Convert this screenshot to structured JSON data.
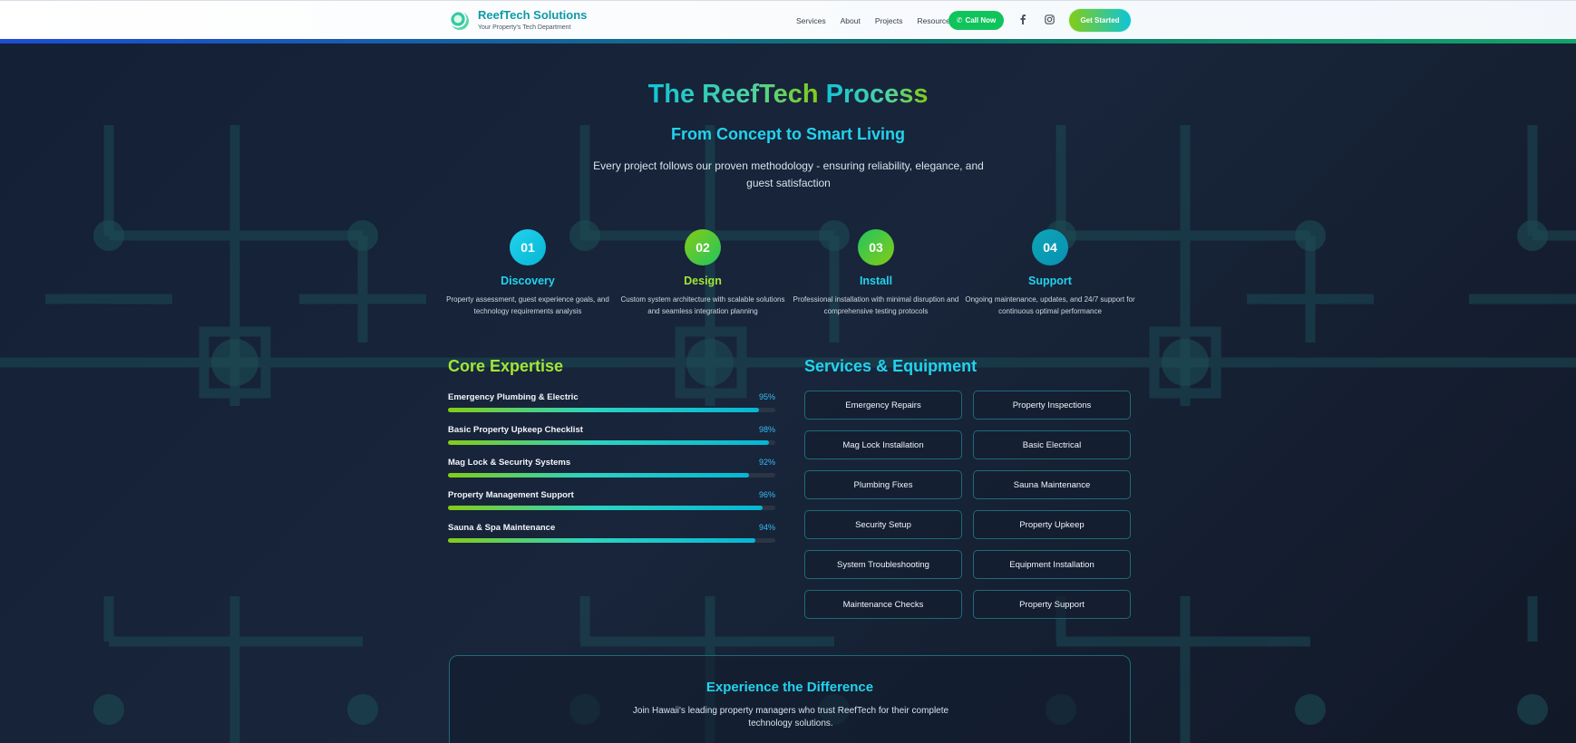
{
  "header": {
    "brand_name": "ReefTech Solutions",
    "brand_tagline": "Your Property's Tech Department",
    "nav": [
      "Services",
      "About",
      "Projects",
      "Resources"
    ],
    "call_label": "Call Now",
    "cta_label": "Get Started",
    "social_icons": [
      "facebook-icon",
      "instagram-icon"
    ]
  },
  "hero": {
    "title_part1": "The ReefTech",
    "title_part2": "Process",
    "subtitle": "From Concept to Smart Living",
    "lead": "Every project follows our proven methodology - ensuring reliability, elegance, and guest satisfaction"
  },
  "steps": [
    {
      "num": "01",
      "name": "Discovery",
      "desc": "Property assessment, guest experience goals, and technology requirements analysis",
      "color": "#22d3ee"
    },
    {
      "num": "02",
      "name": "Design",
      "desc": "Custom system architecture with scalable solutions and seamless integration planning",
      "color": "#a3e635"
    },
    {
      "num": "03",
      "name": "Install",
      "desc": "Professional installation with minimal disruption and comprehensive testing protocols",
      "color": "#22d3ee"
    },
    {
      "num": "04",
      "name": "Support",
      "desc": "Ongoing maintenance, updates, and 24/7 support for continuous optimal performance",
      "color": "#22d3ee"
    }
  ],
  "expertise": {
    "title": "Core Expertise",
    "items": [
      {
        "name": "Emergency Plumbing & Electric",
        "pct_label": "95%",
        "value": 0.95
      },
      {
        "name": "Basic Property Upkeep Checklist",
        "pct_label": "98%",
        "value": 0.98
      },
      {
        "name": "Mag Lock & Security Systems",
        "pct_label": "92%",
        "value": 0.92
      },
      {
        "name": "Property Management Support",
        "pct_label": "96%",
        "value": 0.96
      },
      {
        "name": "Sauna & Spa Maintenance",
        "pct_label": "94%",
        "value": 0.94
      }
    ]
  },
  "services": {
    "title": "Services & Equipment",
    "items": [
      "Emergency Repairs",
      "Property Inspections",
      "Mag Lock Installation",
      "Basic Electrical",
      "Plumbing Fixes",
      "Sauna Maintenance",
      "Security Setup",
      "Property Upkeep",
      "System Troubleshooting",
      "Equipment Installation",
      "Maintenance Checks",
      "Property Support"
    ]
  },
  "cta": {
    "title": "Experience the Difference",
    "desc": "Join Hawaii's leading property managers who trust ReefTech for their complete technology solutions."
  },
  "colors": {
    "accent_cyan": "#22d3ee",
    "accent_lime": "#84cc16",
    "bg": "#141c2e"
  }
}
